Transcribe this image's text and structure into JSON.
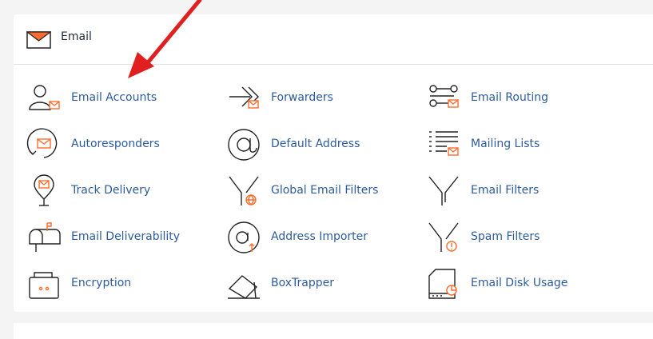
{
  "section": {
    "title": "Email",
    "icon": "envelope-icon"
  },
  "items": [
    {
      "label": "Email Accounts",
      "icon": "email-accounts-icon"
    },
    {
      "label": "Forwarders",
      "icon": "forwarders-icon"
    },
    {
      "label": "Email Routing",
      "icon": "email-routing-icon"
    },
    {
      "label": "Autoresponders",
      "icon": "autoresponders-icon"
    },
    {
      "label": "Default Address",
      "icon": "default-address-icon"
    },
    {
      "label": "Mailing Lists",
      "icon": "mailing-lists-icon"
    },
    {
      "label": "Track Delivery",
      "icon": "track-delivery-icon"
    },
    {
      "label": "Global Email Filters",
      "icon": "global-email-filters-icon"
    },
    {
      "label": "Email Filters",
      "icon": "email-filters-icon"
    },
    {
      "label": "Email Deliverability",
      "icon": "email-deliverability-icon"
    },
    {
      "label": "Address Importer",
      "icon": "address-importer-icon"
    },
    {
      "label": "Spam Filters",
      "icon": "spam-filters-icon"
    },
    {
      "label": "Encryption",
      "icon": "encryption-icon"
    },
    {
      "label": "BoxTrapper",
      "icon": "boxtrapper-icon"
    },
    {
      "label": "Email Disk Usage",
      "icon": "email-disk-usage-icon"
    }
  ],
  "colors": {
    "link": "#2d5c9c",
    "accent": "#ff6c2c",
    "annotation_arrow": "#e02020"
  }
}
